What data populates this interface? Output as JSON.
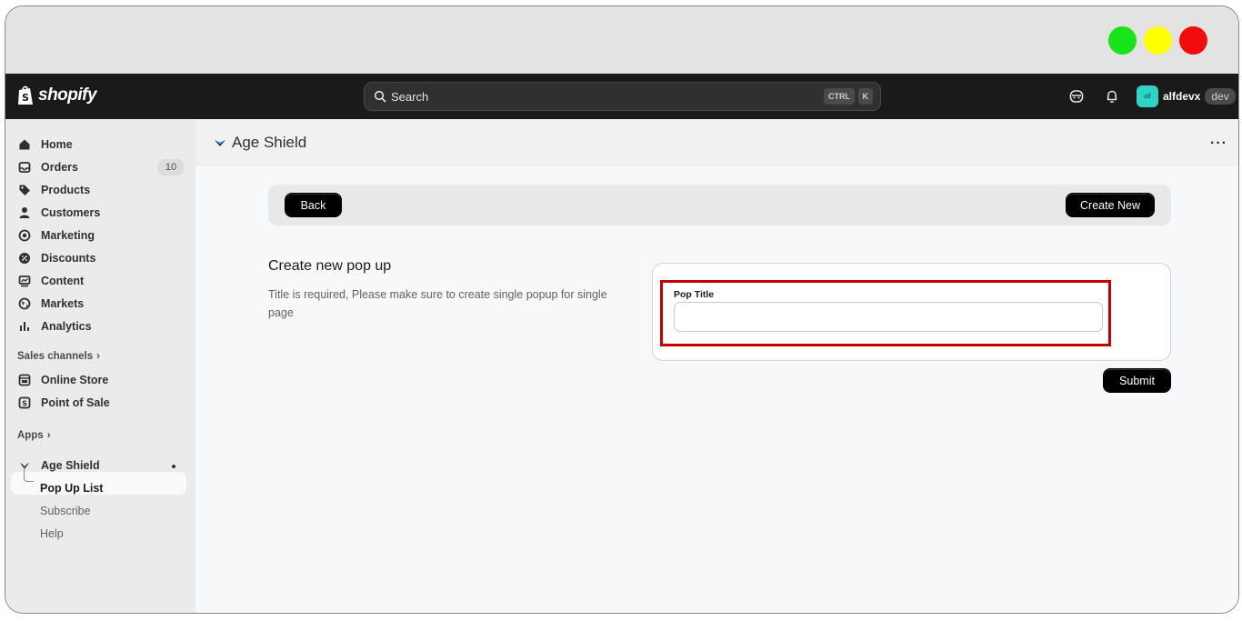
{
  "window": {
    "controls": [
      "green",
      "yellow",
      "red"
    ],
    "colors": {
      "green": "#19e319",
      "yellow": "#ffff00",
      "red": "#f20d0d"
    }
  },
  "topbar": {
    "logo_text": "shopify",
    "search_label": "Search",
    "shortcut_ctrl": "CTRL",
    "shortcut_k": "K",
    "account_initials": "alf",
    "account_name": "alfdevx",
    "account_badge": "dev"
  },
  "sidebar": {
    "items": [
      {
        "label": "Home",
        "icon": "home-icon"
      },
      {
        "label": "Orders",
        "icon": "orders-icon",
        "badge": "10"
      },
      {
        "label": "Products",
        "icon": "tag-icon"
      },
      {
        "label": "Customers",
        "icon": "person-icon"
      },
      {
        "label": "Marketing",
        "icon": "target-icon"
      },
      {
        "label": "Discounts",
        "icon": "discount-icon"
      },
      {
        "label": "Content",
        "icon": "content-icon"
      },
      {
        "label": "Markets",
        "icon": "globe-icon"
      },
      {
        "label": "Analytics",
        "icon": "bar-chart-icon"
      }
    ],
    "sales_channels_label": "Sales channels",
    "sales_channels": [
      {
        "label": "Online Store",
        "icon": "store-icon"
      },
      {
        "label": "Point of Sale",
        "icon": "pos-icon"
      }
    ],
    "apps_label": "Apps",
    "app_name": "Age Shield",
    "app_subitems": [
      "Pop Up List",
      "Subscribe",
      "Help"
    ]
  },
  "main": {
    "app_title": "Age Shield",
    "more_label": "···",
    "back_label": "Back",
    "create_label": "Create New",
    "form_heading": "Create new pop up",
    "form_description": "Title is required, Please make sure to create single popup for single page",
    "field_label": "Pop Title",
    "field_value": "",
    "submit_label": "Submit",
    "highlight_color": "#c40000"
  }
}
